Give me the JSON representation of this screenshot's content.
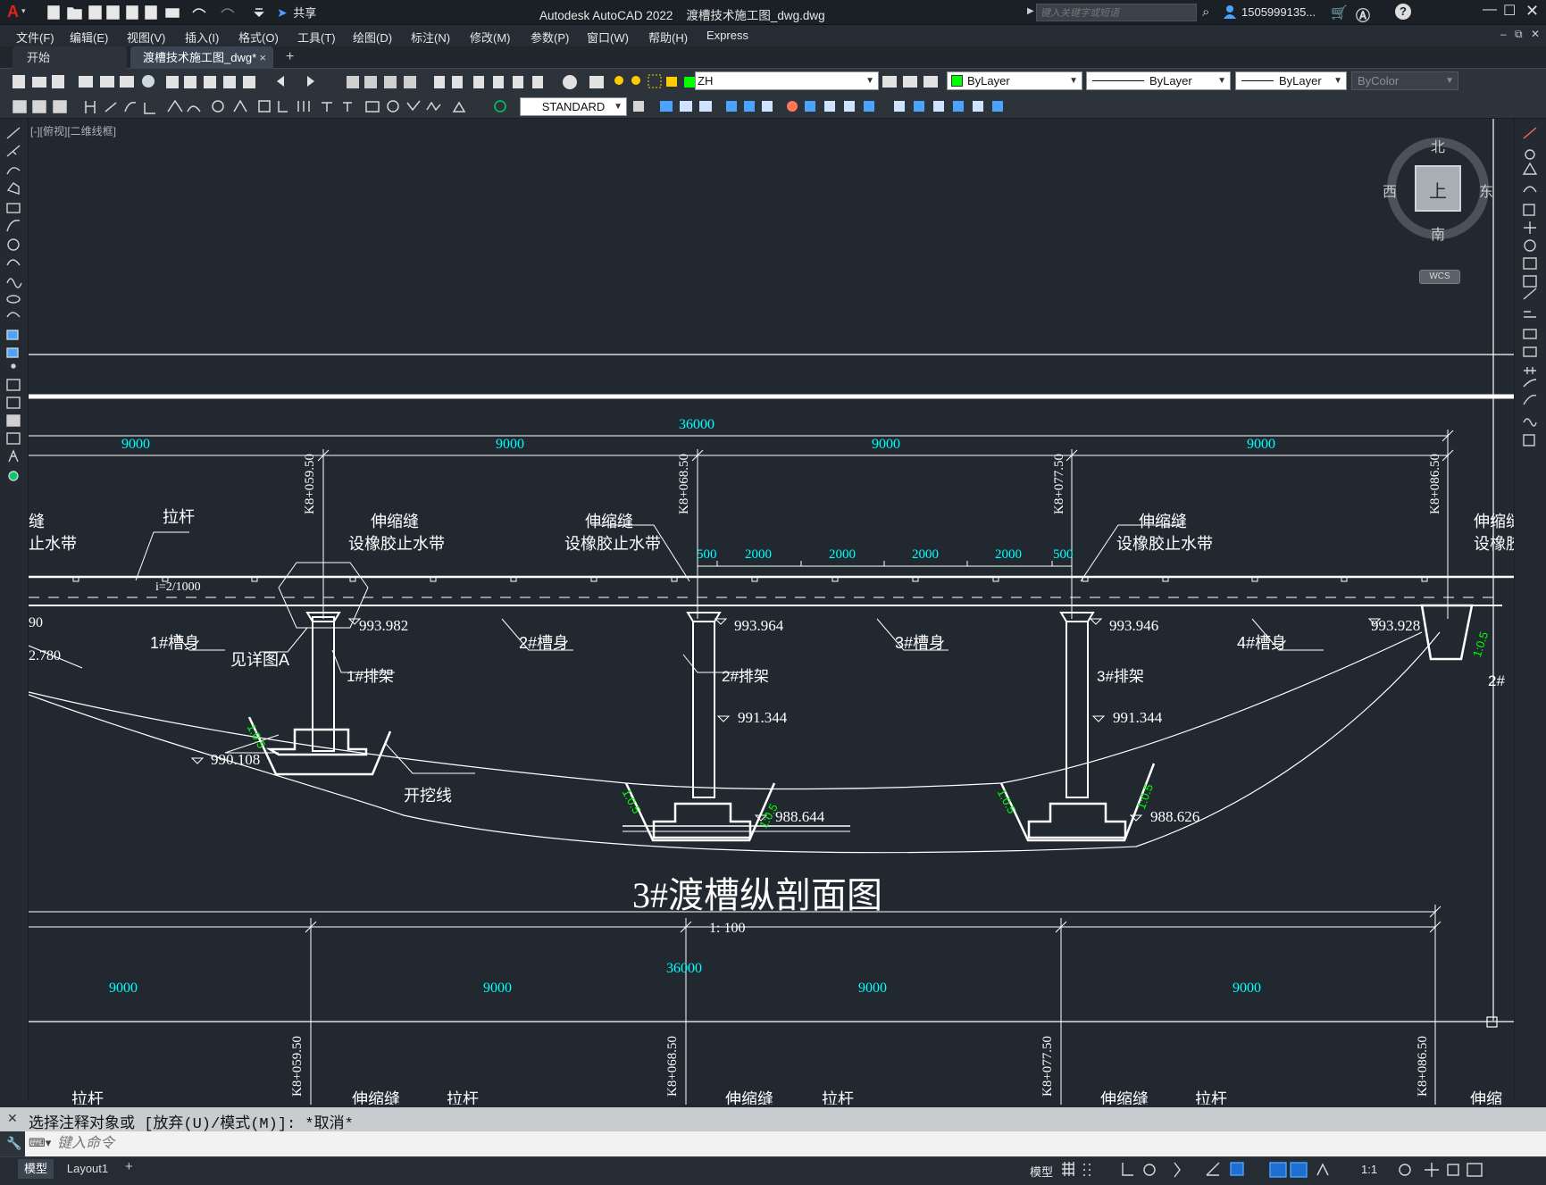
{
  "window": {
    "title": "Autodesk AutoCAD 2022    渡槽技术施工图_dwg.dwg",
    "search_placeholder": "键入关键字或短语",
    "user": "1505999135...",
    "share_label": "共享",
    "app_menu_letter": "A"
  },
  "menu": {
    "items": [
      "文件(F)",
      "编辑(E)",
      "视图(V)",
      "插入(I)",
      "格式(O)",
      "工具(T)",
      "绘图(D)",
      "标注(N)",
      "修改(M)",
      "参数(P)",
      "窗口(W)",
      "帮助(H)",
      "Express"
    ]
  },
  "tabs": {
    "start": "开始",
    "file": "渡槽技术施工图_dwg*",
    "close_glyph": "×",
    "add_glyph": "+"
  },
  "toolbar": {
    "layer_value": "ZH",
    "color_value": "ByLayer",
    "linetype_value": "ByLayer",
    "lineweight_value": "ByLayer",
    "plotstyle_value": "ByColor",
    "textstyle_value": "STANDARD"
  },
  "viewport": {
    "label": "[-][俯视][二维线框]",
    "compass": {
      "north": "北",
      "south": "南",
      "east": "东",
      "west": "西",
      "top": "上",
      "wcs": "WCS"
    }
  },
  "drawing": {
    "overall_dim": "36000",
    "span_dim": "9000",
    "sub_dims": [
      "500",
      "2000",
      "2000",
      "2000",
      "2000",
      "500"
    ],
    "stations": [
      "K8+059.50",
      "K8+068.50",
      "K8+077.50",
      "K8+086.50"
    ],
    "labels": {
      "tie_rod": "拉杆",
      "joint": "伸缩缝",
      "waterstop": "设橡胶止水带",
      "slope": "i=2/1000",
      "trough1": "1#槽身",
      "trough2": "2#槽身",
      "trough3": "3#槽身",
      "trough4": "4#槽身",
      "detail": "见详图A",
      "frame1": "1#排架",
      "frame2": "2#排架",
      "frame3": "3#排架",
      "excavation": "开挖线",
      "ratio": "1:0.5",
      "left_cut1": "缝",
      "left_cut2": "止水带",
      "right_cut1": "伸缩缝",
      "right_cut2": "设橡胶",
      "right_frame": "2#",
      "left_elev1": "90",
      "left_elev2": "2.780"
    },
    "elevations": [
      "993.982",
      "993.964",
      "993.946",
      "993.928",
      "991.344",
      "991.344",
      "990.108",
      "988.644",
      "988.626"
    ],
    "title": "3#渡槽纵剖面图",
    "scale": "1: 100"
  },
  "command": {
    "history": "选择注释对象或 [放弃(U)/模式(M)]: *取消*",
    "placeholder": "键入命令"
  },
  "status": {
    "tab_model": "模型",
    "tab_layout": "Layout1",
    "add_glyph": "+",
    "model_label": "模型",
    "scale": "1:1"
  },
  "colors": {
    "canvas": "#212830",
    "cyan": "#00ffff",
    "green": "#00ff00",
    "white": "#ffffff"
  }
}
